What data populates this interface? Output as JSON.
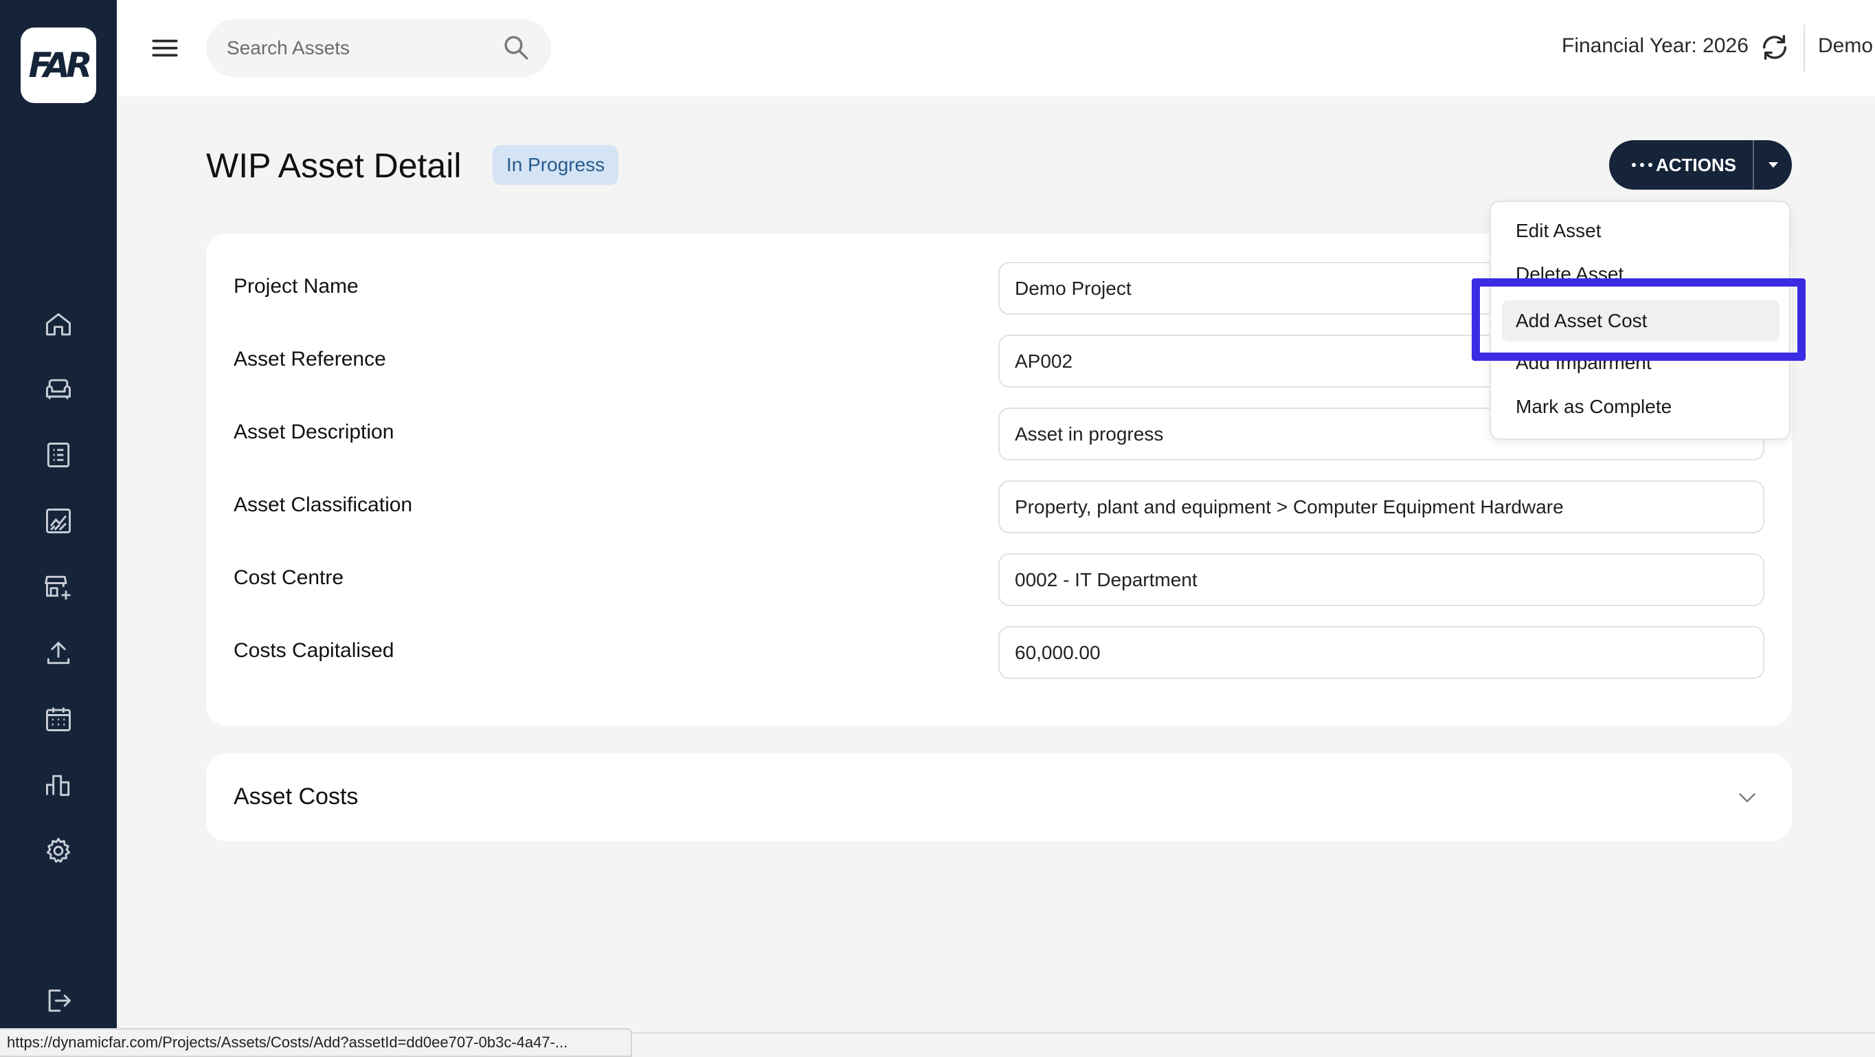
{
  "app": {
    "logo_text": "FAR",
    "brand_color": "#16243a",
    "accent_highlight_color": "#3b2be3"
  },
  "sidebar": {
    "items": [
      {
        "name": "home",
        "icon": "home-icon"
      },
      {
        "name": "assets",
        "icon": "sofa-icon"
      },
      {
        "name": "register",
        "icon": "list-icon"
      },
      {
        "name": "reports",
        "icon": "chart-icon"
      },
      {
        "name": "add-store",
        "icon": "store-add-icon"
      },
      {
        "name": "upload",
        "icon": "upload-icon"
      },
      {
        "name": "calendar",
        "icon": "calendar-icon"
      },
      {
        "name": "analytics",
        "icon": "bar-chart-icon"
      },
      {
        "name": "settings",
        "icon": "gear-icon"
      }
    ],
    "logout_icon": "logout-icon"
  },
  "header": {
    "search_placeholder": "Search Assets",
    "financial_year": "Financial Year: 2026",
    "entity": "Demo Entity"
  },
  "page": {
    "title": "WIP Asset Detail",
    "status": "In Progress",
    "actions_label": "ACTIONS"
  },
  "details": [
    {
      "label": "Project Name",
      "value": "Demo Project"
    },
    {
      "label": "Asset Reference",
      "value": "AP002"
    },
    {
      "label": "Asset Description",
      "value": "Asset in progress"
    },
    {
      "label": "Asset Classification",
      "value": "Property, plant and equipment > Computer Equipment Hardware"
    },
    {
      "label": "Cost Centre",
      "value": "0002 - IT Department"
    },
    {
      "label": "Costs Capitalised",
      "value": "60,000.00"
    }
  ],
  "costs_section": {
    "title": "Asset Costs"
  },
  "actions_menu": {
    "items": [
      "Edit Asset",
      "Delete Asset",
      "Add Asset Cost",
      "Add Impairment",
      "Mark as Complete"
    ],
    "hovered": "Add Asset Cost"
  },
  "status_bar": {
    "url": "https://dynamicfar.com/Projects/Assets/Costs/Add?assetId=dd0ee707-0b3c-4a47-..."
  }
}
